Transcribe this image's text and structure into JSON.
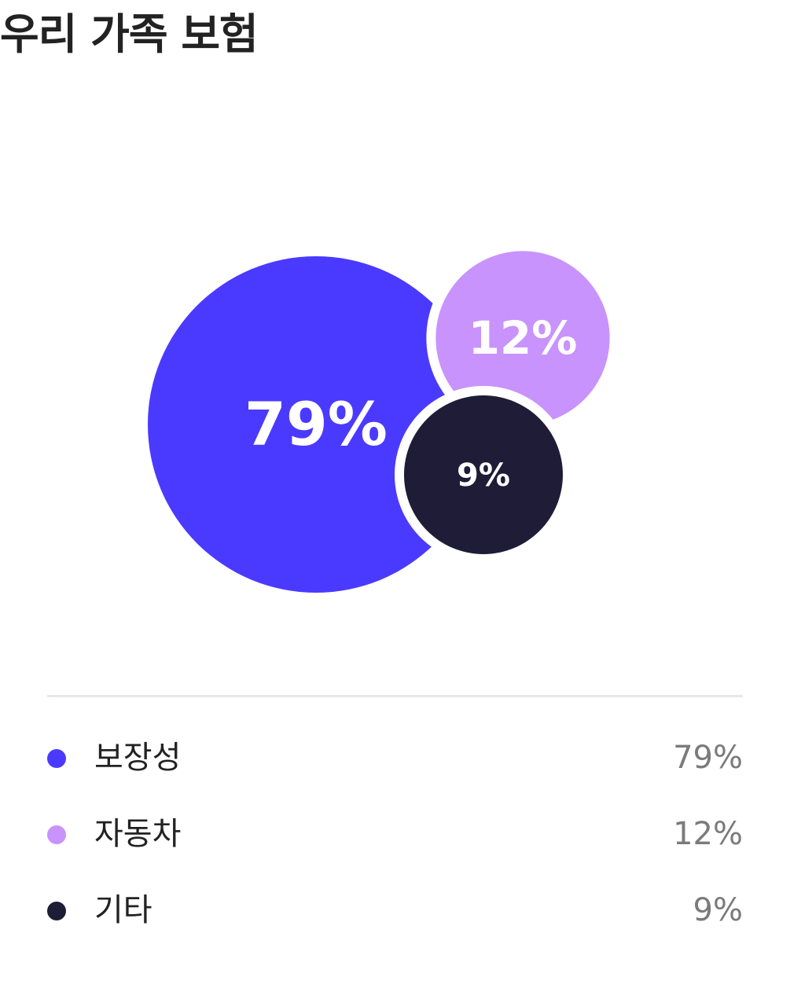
{
  "title": "우리 가족 보험",
  "colors": {
    "title": "#222222",
    "divider": "#e8e8e8",
    "label_text": "#222222",
    "value_text": "#7b7b7b",
    "bubble_label": "#ffffff",
    "gap": "#ffffff"
  },
  "chart_data": {
    "type": "bubble",
    "title": "우리 가족 보험",
    "series": [
      {
        "name": "보장성",
        "value": 79,
        "label": "79%",
        "color": "#4a3aff"
      },
      {
        "name": "자동차",
        "value": 12,
        "label": "12%",
        "color": "#c893fd"
      },
      {
        "name": "기타",
        "value": 9,
        "label": "9%",
        "color": "#1f1c37"
      }
    ]
  },
  "legend": [
    {
      "label": "보장성",
      "value": "79%",
      "color": "#4a3aff"
    },
    {
      "label": "자동차",
      "value": "12%",
      "color": "#c893fd"
    },
    {
      "label": "기타",
      "value": "9%",
      "color": "#1f1c37"
    }
  ]
}
